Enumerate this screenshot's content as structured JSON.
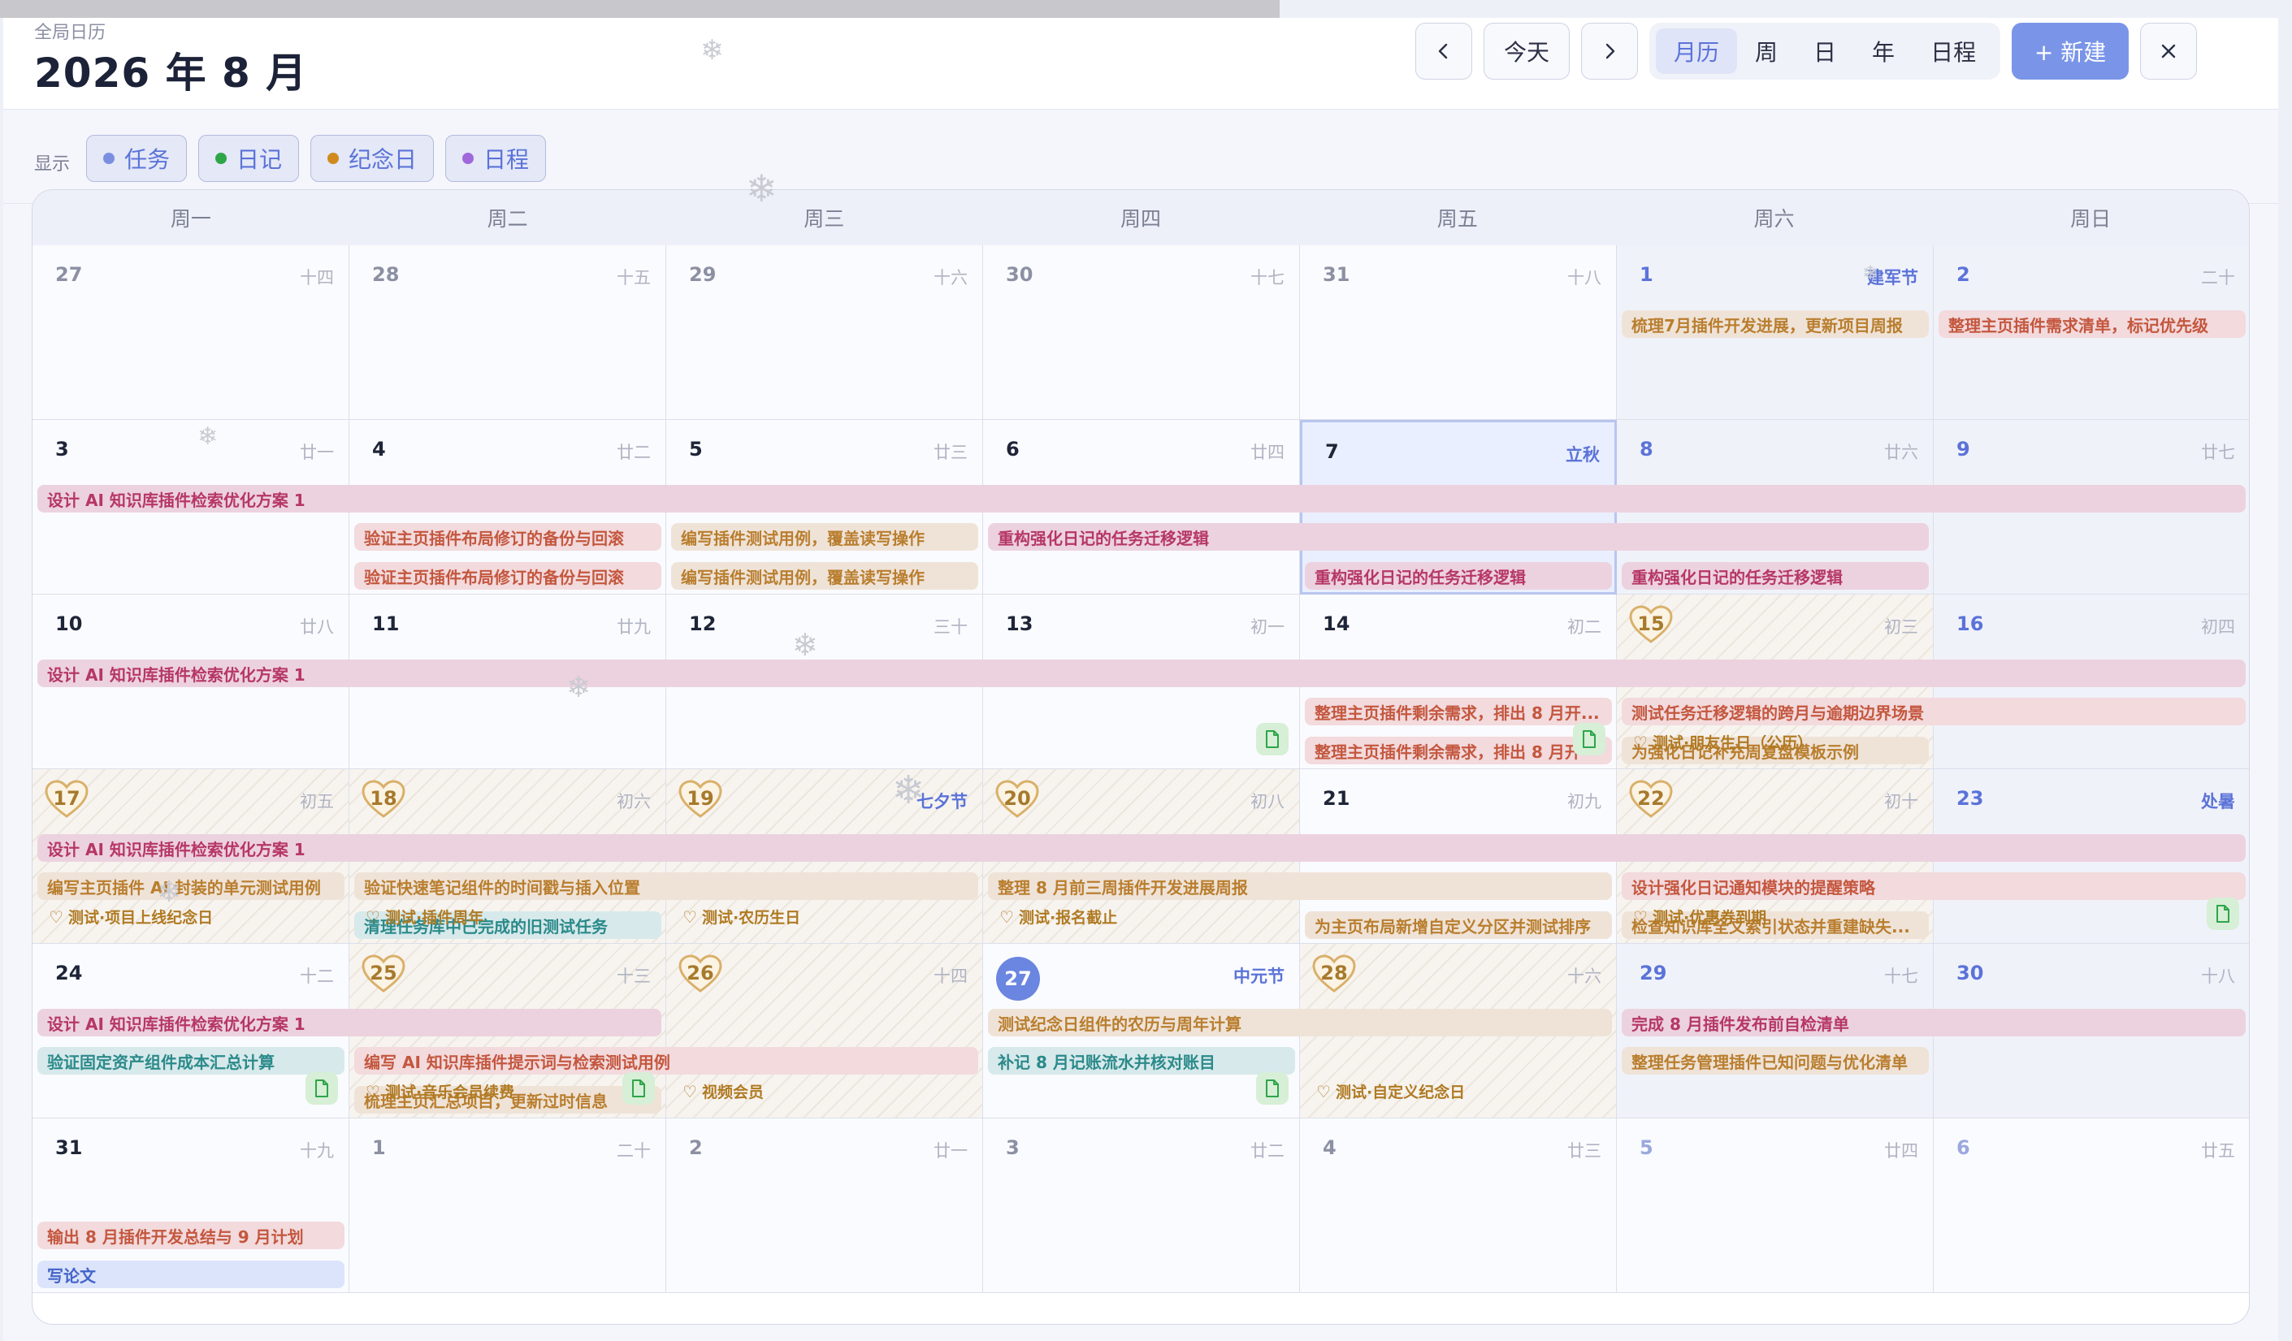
{
  "app": {
    "subtitle": "全局日历",
    "title": "2026 年 8 月"
  },
  "toolbar": {
    "prev_icon": "‹",
    "today_label": "今天",
    "next_icon": "›",
    "views": [
      "月历",
      "周",
      "日",
      "年",
      "日程"
    ],
    "active_view": "月历",
    "new_label": "+ 新建",
    "close_icon": "✕"
  },
  "filters": {
    "label": "显示",
    "items": [
      {
        "label": "任务",
        "color": "#7b8fe0"
      },
      {
        "label": "日记",
        "color": "#2fa54a"
      },
      {
        "label": "纪念日",
        "color": "#d08a1e"
      },
      {
        "label": "日程",
        "color": "#a168dc"
      }
    ]
  },
  "weekdays": [
    "周一",
    "周二",
    "周三",
    "周四",
    "周五",
    "周六",
    "周日"
  ],
  "colors": {
    "accent": "#6b86e0",
    "pink": "#b63766",
    "tan": "#b97e2e",
    "teal": "#2b8a8a",
    "anniversary": "#b07a22"
  },
  "days": [
    {
      "n": "27",
      "lunar": "十四",
      "dim": true
    },
    {
      "n": "28",
      "lunar": "十五",
      "dim": true
    },
    {
      "n": "29",
      "lunar": "十六",
      "dim": true
    },
    {
      "n": "30",
      "lunar": "十七",
      "dim": true
    },
    {
      "n": "31",
      "lunar": "十八",
      "dim": true
    },
    {
      "n": "1",
      "lunar": "建军节",
      "fest": true,
      "weekend": true
    },
    {
      "n": "2",
      "lunar": "二十",
      "weekend": true
    },
    {
      "n": "3",
      "lunar": "廿一"
    },
    {
      "n": "4",
      "lunar": "廿二"
    },
    {
      "n": "5",
      "lunar": "廿三"
    },
    {
      "n": "6",
      "lunar": "廿四"
    },
    {
      "n": "7",
      "lunar": "立秋",
      "fest": true,
      "today": true
    },
    {
      "n": "8",
      "lunar": "廿六",
      "weekend": true
    },
    {
      "n": "9",
      "lunar": "廿七",
      "weekend": true
    },
    {
      "n": "10",
      "lunar": "廿八"
    },
    {
      "n": "11",
      "lunar": "廿九"
    },
    {
      "n": "12",
      "lunar": "三十"
    },
    {
      "n": "13",
      "lunar": "初一"
    },
    {
      "n": "14",
      "lunar": "初二"
    },
    {
      "n": "15",
      "lunar": "初三",
      "anniv": true
    },
    {
      "n": "16",
      "lunar": "初四",
      "weekend": true
    },
    {
      "n": "17",
      "lunar": "初五",
      "anniv": true
    },
    {
      "n": "18",
      "lunar": "初六",
      "anniv": true
    },
    {
      "n": "19",
      "lunar": "七夕节",
      "fest": true,
      "anniv": true
    },
    {
      "n": "20",
      "lunar": "初八",
      "anniv": true
    },
    {
      "n": "21",
      "lunar": "初九"
    },
    {
      "n": "22",
      "lunar": "初十",
      "anniv": true
    },
    {
      "n": "23",
      "lunar": "处暑",
      "fest": true,
      "weekend": true
    },
    {
      "n": "24",
      "lunar": "十二"
    },
    {
      "n": "25",
      "lunar": "十三",
      "anniv": true
    },
    {
      "n": "26",
      "lunar": "十四",
      "anniv": true
    },
    {
      "n": "27",
      "lunar": "中元节",
      "fest": true,
      "selected": true
    },
    {
      "n": "28",
      "lunar": "十六",
      "anniv": true
    },
    {
      "n": "29",
      "lunar": "十七",
      "weekend": true
    },
    {
      "n": "30",
      "lunar": "十八",
      "weekend": true
    },
    {
      "n": "31",
      "lunar": "十九"
    },
    {
      "n": "1",
      "lunar": "二十",
      "dim": true
    },
    {
      "n": "2",
      "lunar": "廿一",
      "dim": true
    },
    {
      "n": "3",
      "lunar": "廿二",
      "dim": true
    },
    {
      "n": "4",
      "lunar": "廿三",
      "dim": true
    },
    {
      "n": "5",
      "lunar": "廿四",
      "dim": true,
      "weekend": true
    },
    {
      "n": "6",
      "lunar": "廿五",
      "dim": true,
      "weekend": true
    }
  ],
  "events": [
    {
      "text": "梳理7月插件开发进展，更新项目周报",
      "row": 0,
      "col": 5,
      "span": 1,
      "slot": 0,
      "style": "tan"
    },
    {
      "text": "整理主页插件需求清单，标记优先级",
      "row": 0,
      "col": 6,
      "span": 1,
      "slot": 0,
      "style": "peach"
    },
    {
      "text": "设计 AI 知识库插件检索优化方案 1",
      "row": 1,
      "col": 0,
      "span": 7,
      "slot": 0,
      "style": "pink"
    },
    {
      "text": "验证主页插件布局修订的备份与回滚",
      "row": 1,
      "col": 1,
      "span": 1,
      "slot": 1,
      "style": "peach"
    },
    {
      "text": "编写插件测试用例，覆盖读写操作",
      "row": 1,
      "col": 2,
      "span": 1,
      "slot": 1,
      "style": "tan"
    },
    {
      "text": "重构强化日记的任务迁移逻辑",
      "row": 1,
      "col": 3,
      "span": 3,
      "slot": 1,
      "style": "pink"
    },
    {
      "text": "验证主页插件布局修订的备份与回滚",
      "row": 1,
      "col": 1,
      "span": 1,
      "slot": 2,
      "style": "peach"
    },
    {
      "text": "编写插件测试用例，覆盖读写操作",
      "row": 1,
      "col": 2,
      "span": 1,
      "slot": 2,
      "style": "tan"
    },
    {
      "text": "重构强化日记的任务迁移逻辑",
      "row": 1,
      "col": 4,
      "span": 1,
      "slot": 2,
      "style": "pink"
    },
    {
      "text": "重构强化日记的任务迁移逻辑",
      "row": 1,
      "col": 5,
      "span": 1,
      "slot": 2,
      "style": "pink"
    },
    {
      "text": "设计 AI 知识库插件检索优化方案 1",
      "row": 2,
      "col": 0,
      "span": 7,
      "slot": 0,
      "style": "pink"
    },
    {
      "text": "整理主页插件剩余需求，排出 8 月开...",
      "row": 2,
      "col": 4,
      "span": 1,
      "slot": 1,
      "style": "peach"
    },
    {
      "text": "测试任务迁移逻辑的跨月与逾期边界场景",
      "row": 2,
      "col": 5,
      "span": 2,
      "slot": 1,
      "style": "peach"
    },
    {
      "text": "整理主页插件剩余需求，排出 8 月开",
      "row": 2,
      "col": 4,
      "span": 1,
      "slot": 2,
      "style": "peach"
    },
    {
      "text": "为强化日记补充周复盘模板示例",
      "row": 2,
      "col": 5,
      "span": 1,
      "slot": 2,
      "style": "tan"
    },
    {
      "text": "设计 AI 知识库插件检索优化方案 1",
      "row": 3,
      "col": 0,
      "span": 7,
      "slot": 0,
      "style": "pink"
    },
    {
      "text": "编写主页插件 AI 封装的单元测试用例",
      "row": 3,
      "col": 0,
      "span": 1,
      "slot": 1,
      "style": "tan"
    },
    {
      "text": "验证快速笔记组件的时间戳与插入位置",
      "row": 3,
      "col": 1,
      "span": 2,
      "slot": 1,
      "style": "tan"
    },
    {
      "text": "整理 8 月前三周插件开发进展周报",
      "row": 3,
      "col": 3,
      "span": 2,
      "slot": 1,
      "style": "tan"
    },
    {
      "text": "设计强化日记通知模块的提醒策略",
      "row": 3,
      "col": 5,
      "span": 2,
      "slot": 1,
      "style": "peach"
    },
    {
      "text": "清理任务库中已完成的旧测试任务",
      "row": 3,
      "col": 1,
      "span": 1,
      "slot": 2,
      "style": "teal"
    },
    {
      "text": "为主页布局新增自定义分区并测试排序",
      "row": 3,
      "col": 4,
      "span": 1,
      "slot": 2,
      "style": "tan"
    },
    {
      "text": "检查知识库全文索引状态并重建缺失...",
      "row": 3,
      "col": 5,
      "span": 1,
      "slot": 2,
      "style": "tan"
    },
    {
      "text": "设计 AI 知识库插件检索优化方案 1",
      "row": 4,
      "col": 0,
      "span": 2,
      "slot": 0,
      "style": "pink"
    },
    {
      "text": "测试纪念日组件的农历与周年计算",
      "row": 4,
      "col": 3,
      "span": 2,
      "slot": 0,
      "style": "tan"
    },
    {
      "text": "完成 8 月插件发布前自检清单",
      "row": 4,
      "col": 5,
      "span": 2,
      "slot": 0,
      "style": "pink"
    },
    {
      "text": "验证固定资产组件成本汇总计算",
      "row": 4,
      "col": 0,
      "span": 1,
      "slot": 1,
      "style": "teal"
    },
    {
      "text": "编写 AI 知识库插件提示词与检索测试用例",
      "row": 4,
      "col": 1,
      "span": 2,
      "slot": 1,
      "style": "peach"
    },
    {
      "text": "补记 8 月记账流水并核对账目",
      "row": 4,
      "col": 3,
      "span": 1,
      "slot": 1,
      "style": "teal"
    },
    {
      "text": "整理任务管理插件已知问题与优化清单",
      "row": 4,
      "col": 5,
      "span": 1,
      "slot": 1,
      "style": "tan"
    },
    {
      "text": "梳理主页汇总项目，更新过时信息",
      "row": 4,
      "col": 1,
      "span": 1,
      "slot": 2,
      "style": "tan"
    },
    {
      "text": "输出 8 月插件开发总结与 9 月计划",
      "row": 5,
      "col": 0,
      "span": 1,
      "slot": 1,
      "style": "peach"
    },
    {
      "text": "写论文",
      "row": 5,
      "col": 0,
      "span": 1,
      "slot": 2,
      "style": "blue"
    }
  ],
  "notes": [
    {
      "text": "测试·朋友生日（公历）",
      "row": 2,
      "col": 5
    },
    {
      "text": "测试·项目上线纪念日",
      "row": 3,
      "col": 0
    },
    {
      "text": "测试·插件周年",
      "row": 3,
      "col": 1
    },
    {
      "text": "测试·农历生日",
      "row": 3,
      "col": 2
    },
    {
      "text": "测试·报名截止",
      "row": 3,
      "col": 3
    },
    {
      "text": "测试·优惠券到期",
      "row": 3,
      "col": 5
    },
    {
      "text": "测试·音乐会员续费",
      "row": 4,
      "col": 1
    },
    {
      "text": "视频会员",
      "row": 4,
      "col": 2
    },
    {
      "text": "测试·自定义纪念日",
      "row": 4,
      "col": 4
    }
  ],
  "docs": [
    {
      "row": 2,
      "col": 3
    },
    {
      "row": 2,
      "col": 4
    },
    {
      "row": 3,
      "col": 6
    },
    {
      "row": 4,
      "col": 0
    },
    {
      "row": 4,
      "col": 1
    },
    {
      "row": 4,
      "col": 3
    }
  ]
}
